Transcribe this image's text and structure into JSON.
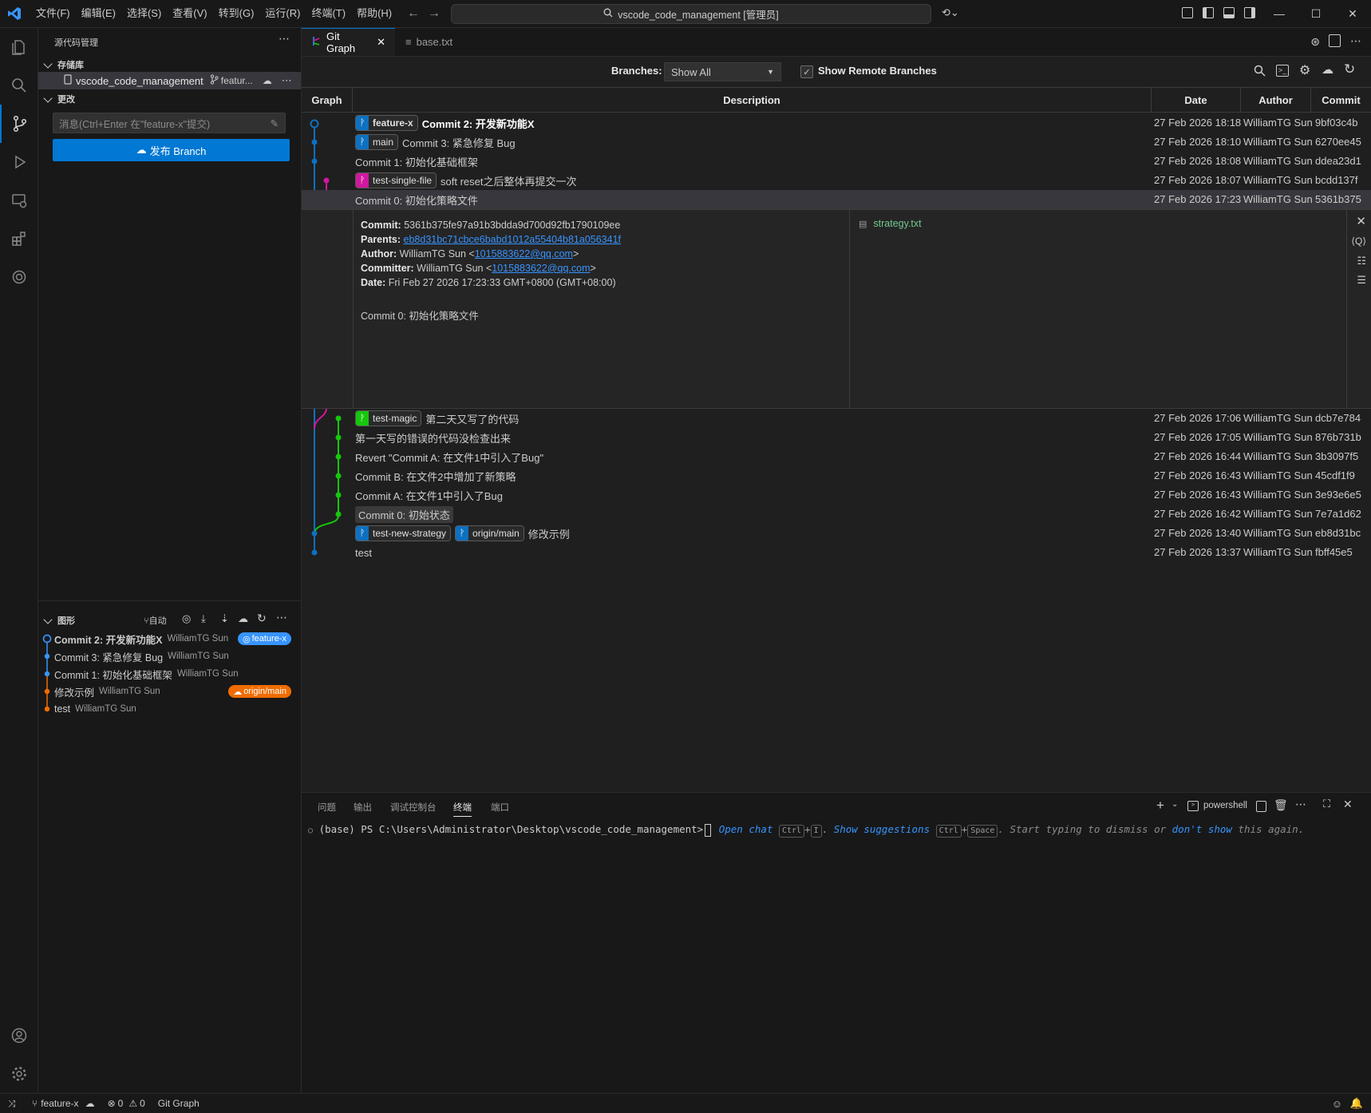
{
  "menu": [
    "文件(F)",
    "编辑(E)",
    "选择(S)",
    "查看(V)",
    "转到(G)",
    "运行(R)",
    "终端(T)",
    "帮助(H)"
  ],
  "search": {
    "text": "vscode_code_management [管理员]"
  },
  "sidebar": {
    "title": "源代码管理",
    "repos_label": "存储库",
    "repo_name": "vscode_code_management",
    "repo_branch": "featur...",
    "changes_label": "更改",
    "commit_placeholder": "消息(Ctrl+Enter 在\"feature-x\"提交)",
    "publish_label": "发布 Branch",
    "graph_label": "图形",
    "graph_auto": "自动",
    "graph_items": [
      {
        "msg": "Commit 2: 开发新功能X",
        "author": "WilliamTG Sun",
        "badge": "feature-x",
        "color": "#3794ff"
      },
      {
        "msg": "Commit 3: 紧急修复 Bug",
        "author": "WilliamTG Sun",
        "badge": "",
        "color": "#3794ff"
      },
      {
        "msg": "Commit 1: 初始化基础框架",
        "author": "WilliamTG Sun",
        "badge": "",
        "color": "#3794ff"
      },
      {
        "msg": "修改示例",
        "author": "WilliamTG Sun",
        "badge": "origin/main",
        "color": "#f06c00"
      },
      {
        "msg": "test",
        "author": "WilliamTG Sun",
        "badge": "",
        "color": "#f06c00"
      }
    ]
  },
  "tabs": [
    {
      "label": "Git Graph"
    },
    {
      "label": "base.txt"
    }
  ],
  "toolbar": {
    "branches_label": "Branches:",
    "branches_value": "Show All",
    "remote_label": "Show Remote Branches"
  },
  "table": {
    "headers": {
      "graph": "Graph",
      "description": "Description",
      "date": "Date",
      "author": "Author",
      "commit": "Commit"
    },
    "rows_top": [
      {
        "refs": [
          {
            "name": "feature-x",
            "color": "#0e70c0"
          }
        ],
        "msg": "Commit 2: 开发新功能X",
        "bold": true,
        "date": "27 Feb 2026 18:18",
        "author": "WilliamTG Sun",
        "hash": "9bf03c4b"
      },
      {
        "refs": [
          {
            "name": "main",
            "color": "#0e70c0"
          }
        ],
        "msg": "Commit 3: 紧急修复 Bug",
        "date": "27 Feb 2026 18:10",
        "author": "WilliamTG Sun",
        "hash": "6270ee45"
      },
      {
        "refs": [],
        "msg": "Commit 1: 初始化基础框架",
        "date": "27 Feb 2026 18:08",
        "author": "WilliamTG Sun",
        "hash": "ddea23d1"
      },
      {
        "refs": [
          {
            "name": "test-single-file",
            "color": "#d1179d"
          }
        ],
        "msg": "soft reset之后整体再提交一次",
        "date": "27 Feb 2026 18:07",
        "author": "WilliamTG Sun",
        "hash": "bcdd137f"
      },
      {
        "refs": [],
        "msg": "Commit 0: 初始化策略文件",
        "date": "27 Feb 2026 17:23",
        "author": "WilliamTG Sun",
        "hash": "5361b375",
        "selected": true
      }
    ],
    "rows_bottom": [
      {
        "refs": [
          {
            "name": "test-magic",
            "color": "#16c60c"
          }
        ],
        "msg": "第二天又写了的代码",
        "date": "27 Feb 2026 17:06",
        "author": "WilliamTG Sun",
        "hash": "dcb7e784"
      },
      {
        "refs": [],
        "msg": "第一天写的错误的代码没检查出来",
        "date": "27 Feb 2026 17:05",
        "author": "WilliamTG Sun",
        "hash": "876b731b"
      },
      {
        "refs": [],
        "msg": "Revert \"Commit A: 在文件1中引入了Bug\"",
        "date": "27 Feb 2026 16:44",
        "author": "WilliamTG Sun",
        "hash": "3b3097f5"
      },
      {
        "refs": [],
        "msg": "Commit B: 在文件2中增加了新策略",
        "date": "27 Feb 2026 16:43",
        "author": "WilliamTG Sun",
        "hash": "45cdf1f9"
      },
      {
        "refs": [],
        "msg": "Commit A: 在文件1中引入了Bug",
        "date": "27 Feb 2026 16:43",
        "author": "WilliamTG Sun",
        "hash": "3e93e6e5"
      },
      {
        "refs": [],
        "msg": "Commit 0: 初始状态",
        "date": "27 Feb 2026 16:42",
        "author": "WilliamTG Sun",
        "hash": "7e7a1d62",
        "boxed": true
      },
      {
        "refs": [
          {
            "name": "test-new-strategy",
            "color": "#0e70c0"
          },
          {
            "name": "origin/main",
            "color": "#0e70c0"
          }
        ],
        "msg": "修改示例",
        "date": "27 Feb 2026 13:40",
        "author": "WilliamTG Sun",
        "hash": "eb8d31bc"
      },
      {
        "refs": [],
        "msg": "test",
        "date": "27 Feb 2026 13:37",
        "author": "WilliamTG Sun",
        "hash": "fbff45e5"
      }
    ]
  },
  "detail": {
    "commit_label": "Commit:",
    "commit": "5361b375fe97a91b3bdda9d700d92fb1790109ee",
    "parents_label": "Parents:",
    "parents": "eb8d31bc71cbce6babd1012a55404b81a056341f",
    "author_label": "Author:",
    "author_name": "WilliamTG Sun <",
    "author_email": "1015883622@qq.com",
    "author_end": ">",
    "committer_label": "Committer:",
    "committer_name": "WilliamTG Sun <",
    "committer_email": "1015883622@qq.com",
    "committer_end": ">",
    "date_label": "Date:",
    "date": "Fri Feb 27 2026 17:23:33 GMT+0800 (GMT+08:00)",
    "message": "Commit 0: 初始化策略文件",
    "file": "strategy.txt"
  },
  "panel": {
    "tabs": [
      "问题",
      "输出",
      "调试控制台",
      "终端",
      "端口"
    ],
    "shell": "powershell",
    "prompt": "(base) PS C:\\Users\\Administrator\\Desktop\\vscode_code_management>",
    "hint_open_chat": "Open chat",
    "hint_ctrl": "Ctrl",
    "hint_i": "I",
    "hint_show": "Show suggestions",
    "hint_ctrl2": "Ctrl",
    "hint_space": "Space",
    "hint_tail": ". Start typing to dismiss or",
    "hint_dont": "don't show",
    "hint_end": "this again."
  },
  "status": {
    "branch": "feature-x",
    "errors": "0",
    "warnings": "0",
    "gitgraph": "Git Graph"
  }
}
